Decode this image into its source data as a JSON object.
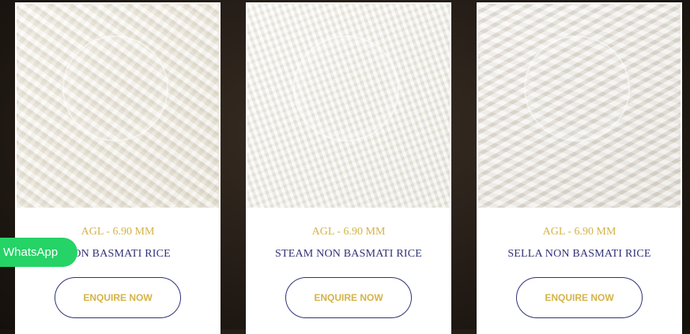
{
  "products": [
    {
      "grade": "AGL - 6.90 MM",
      "name": "NON BASMATI RICE",
      "image_alt": "Raw non basmati rice grains",
      "button_label": "ENQUIRE NOW"
    },
    {
      "grade": "AGL - 6.90 MM",
      "name": "STEAM NON BASMATI RICE",
      "image_alt": "Steam non basmati rice grains",
      "button_label": "ENQUIRE NOW"
    },
    {
      "grade": "AGL - 6.90 MM",
      "name": "SELLA NON BASMATI RICE",
      "image_alt": "Sella non basmati rice grains",
      "button_label": "ENQUIRE NOW"
    }
  ],
  "whatsapp": {
    "label": "WhatsApp",
    "color": "#25d366"
  },
  "colors": {
    "accent_gold": "#d4b347",
    "navy": "#2f3277"
  }
}
